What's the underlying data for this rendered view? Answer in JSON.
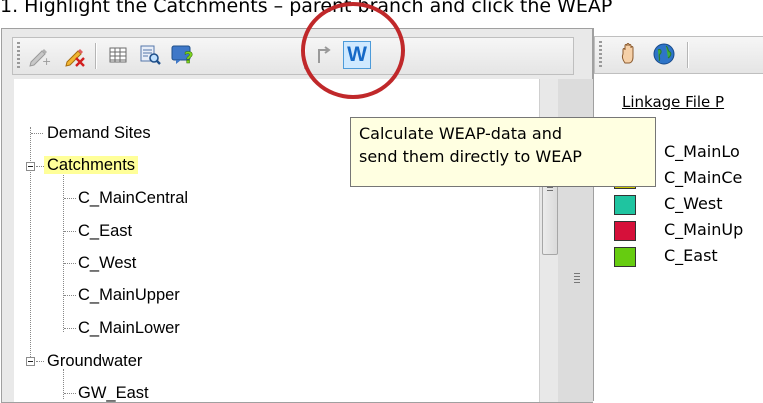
{
  "instruction": "1. Highlight the Catchments – parent branch and click the WEAP",
  "toolbar": {
    "weap_button_label": "W",
    "icons": [
      "edit-pencil-icon",
      "delete-pencil-icon",
      "grid-icon",
      "search-icon",
      "help-icon",
      "undo-icon",
      "weap-icon"
    ]
  },
  "tooltip": {
    "line1": "Calculate WEAP-data and",
    "line2": "send them directly to WEAP"
  },
  "tree": {
    "demand_sites": "Demand Sites",
    "catchments": "Catchments",
    "catchment_children": [
      "C_MainCentral",
      "C_East",
      "C_West",
      "C_MainUpper",
      "C_MainLower"
    ],
    "groundwater": "Groundwater",
    "groundwater_children": [
      "GW_East"
    ]
  },
  "right_panel": {
    "toolbar_icons": [
      "hand-icon",
      "globe-icon"
    ],
    "linkage_title": "Linkage File P",
    "legend": [
      {
        "label": "C_MainLo",
        "color": "#ffffff"
      },
      {
        "label": "C_MainCe",
        "color": "#c9c400"
      },
      {
        "label": "C_West",
        "color": "#1fc4a0"
      },
      {
        "label": "C_MainUp",
        "color": "#d6103a"
      },
      {
        "label": "C_East",
        "color": "#66cc10"
      }
    ]
  },
  "colors": {
    "highlight": "#ffff99",
    "red_circle": "#c0282a",
    "tooltip_bg": "#ffffe1"
  }
}
